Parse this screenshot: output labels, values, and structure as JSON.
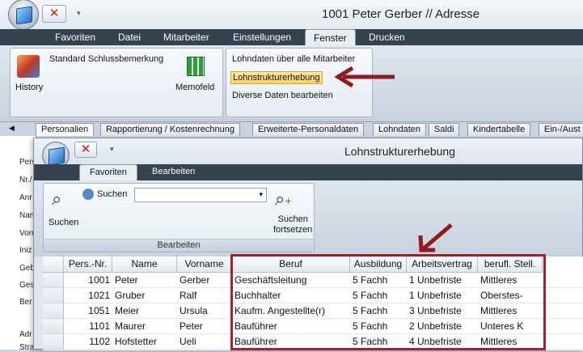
{
  "outer": {
    "title": "1001 Peter Gerber // Adresse",
    "menu": [
      "Favoriten",
      "Datei",
      "Mitarbeiter",
      "Einstellungen",
      "Fenster",
      "Drucken"
    ],
    "active_menu": "Fenster",
    "ribbon": {
      "standard_label": "Standard Schlussbemerkung",
      "history_label": "History",
      "memofeld_label": "Memofeld",
      "items": [
        "Lohndaten über alle Mitarbeiter",
        "Lohnstrukturerhebung",
        "Diverse Daten bearbeiten"
      ]
    },
    "tabs": [
      "Personalien",
      "Rapportierung / Kostenrechnung",
      "Erweiterte-Personaldaten",
      "Lohndaten",
      "Saldi",
      "Kindertabelle",
      "Ein-/Aust"
    ],
    "left_labels": [
      "Pers",
      "Nr./",
      "Anr",
      "Nan",
      "Vorr",
      "Iniz",
      "Geb",
      "Ges",
      "Ber",
      "Adr",
      "Stra"
    ]
  },
  "inner": {
    "title": "Lohnstrukturerhebung",
    "tabs": [
      "Favoriten",
      "Bearbeiten"
    ],
    "search_label": "Suchen",
    "search_value": "",
    "search_button": "Suchen",
    "search_next_line1": "Suchen",
    "search_next_line2": "fortsetzen",
    "group_label": "Bearbeiten"
  },
  "table": {
    "columns": [
      "Pers.-Nr.",
      "Name",
      "Vorname",
      "Beruf",
      "Ausbildung",
      "Arbeitsvertrag",
      "berufl. Stell."
    ],
    "rows": [
      {
        "nr": "1001",
        "name": "Peter",
        "vorname": "Gerber",
        "beruf": "Geschäftsleitung",
        "ausbildung": "5  Fachh",
        "vertrag": "1 Unbefriste",
        "stellung": "Mittleres"
      },
      {
        "nr": "1021",
        "name": "Gruber",
        "vorname": "Ralf",
        "beruf": "Buchhalter",
        "ausbildung": "5  Fachh",
        "vertrag": "1 Unbefriste",
        "stellung": "Oberstes-"
      },
      {
        "nr": "1051",
        "name": "Meier",
        "vorname": "Ursula",
        "beruf": "Kaufm. Angestellte(r)",
        "ausbildung": "5  Fachh",
        "vertrag": "3 Unbefriste",
        "stellung": "Mittleres"
      },
      {
        "nr": "1101",
        "name": "Maurer",
        "vorname": "Peter",
        "beruf": "Bauführer",
        "ausbildung": "5  Fachh",
        "vertrag": "2 Unbefriste",
        "stellung": "Unteres K"
      },
      {
        "nr": "1102",
        "name": "Hofstetter",
        "vorname": "Ueli",
        "beruf": "Bauführer",
        "ausbildung": "5  Fachh",
        "vertrag": "4 Unbefriste",
        "stellung": "Mittleres"
      }
    ]
  },
  "colors": {
    "highlight": "#ffd36a",
    "arrow": "#8e1a22",
    "menubar": "#35424f"
  }
}
